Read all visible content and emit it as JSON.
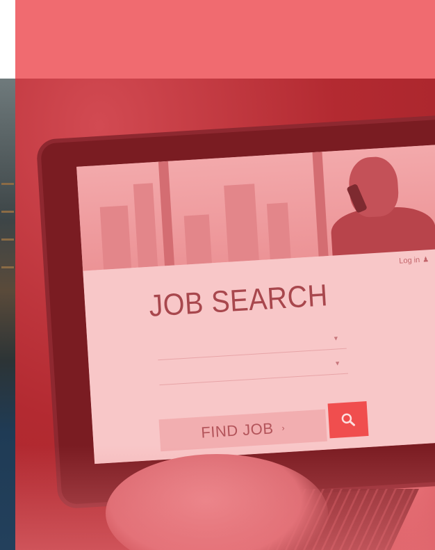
{
  "colors": {
    "banner": "#f06b70",
    "overlay": "#c12f36",
    "search_button": "#f04e4e"
  },
  "screen": {
    "login_label": "Log in",
    "headline": "JOB SEARCH",
    "find_button_label": "FIND JOB",
    "search_icon": "search-icon"
  }
}
